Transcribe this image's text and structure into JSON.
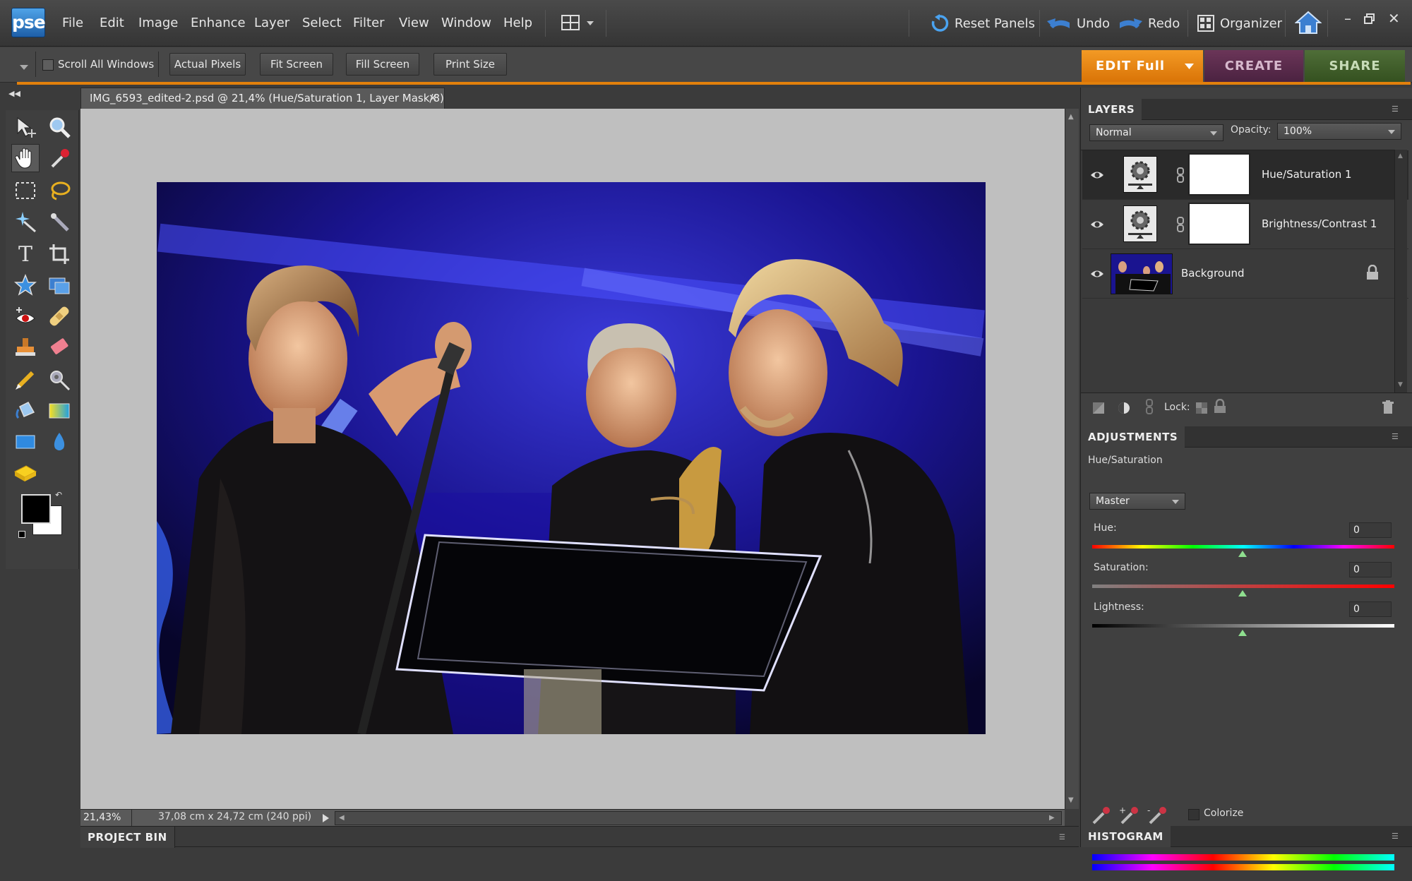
{
  "app": {
    "logo": "pse"
  },
  "menu": [
    "File",
    "Edit",
    "Image",
    "Enhance",
    "Layer",
    "Select",
    "Filter",
    "View",
    "Window",
    "Help"
  ],
  "toolbar": {
    "reset_panels": "Reset Panels",
    "undo": "Undo",
    "redo": "Redo",
    "organizer": "Organizer"
  },
  "options": {
    "scroll_all": "Scroll All Windows",
    "actual_pixels": "Actual Pixels",
    "fit_screen": "Fit Screen",
    "fill_screen": "Fill Screen",
    "print_size": "Print Size"
  },
  "modes": {
    "edit": "EDIT Full",
    "create": "CREATE",
    "share": "SHARE"
  },
  "document": {
    "tab_title": "IMG_6593_edited-2.psd @ 21,4% (Hue/Saturation 1, Layer Mask/8)",
    "zoom": "21,43%",
    "doc_info": "37,08 cm x 24,72 cm (240 ppi)"
  },
  "bins": {
    "project": "PROJECT BIN",
    "histogram": "HISTOGRAM"
  },
  "layers": {
    "title": "LAYERS",
    "blend_mode": "Normal",
    "opacity_label": "Opacity:",
    "opacity": "100%",
    "lock_label": "Lock:",
    "items": [
      {
        "name": "Hue/Saturation 1"
      },
      {
        "name": "Brightness/Contrast 1"
      },
      {
        "name": "Background"
      }
    ]
  },
  "adjustments": {
    "title": "ADJUSTMENTS",
    "subtitle": "Hue/Saturation",
    "channel": "Master",
    "hue_label": "Hue:",
    "hue": "0",
    "saturation_label": "Saturation:",
    "saturation": "0",
    "lightness_label": "Lightness:",
    "lightness": "0",
    "colorize": "Colorize"
  },
  "colors": {
    "accent": "#e2800c",
    "create": "#5a2a48",
    "share": "#3e5a2c"
  }
}
